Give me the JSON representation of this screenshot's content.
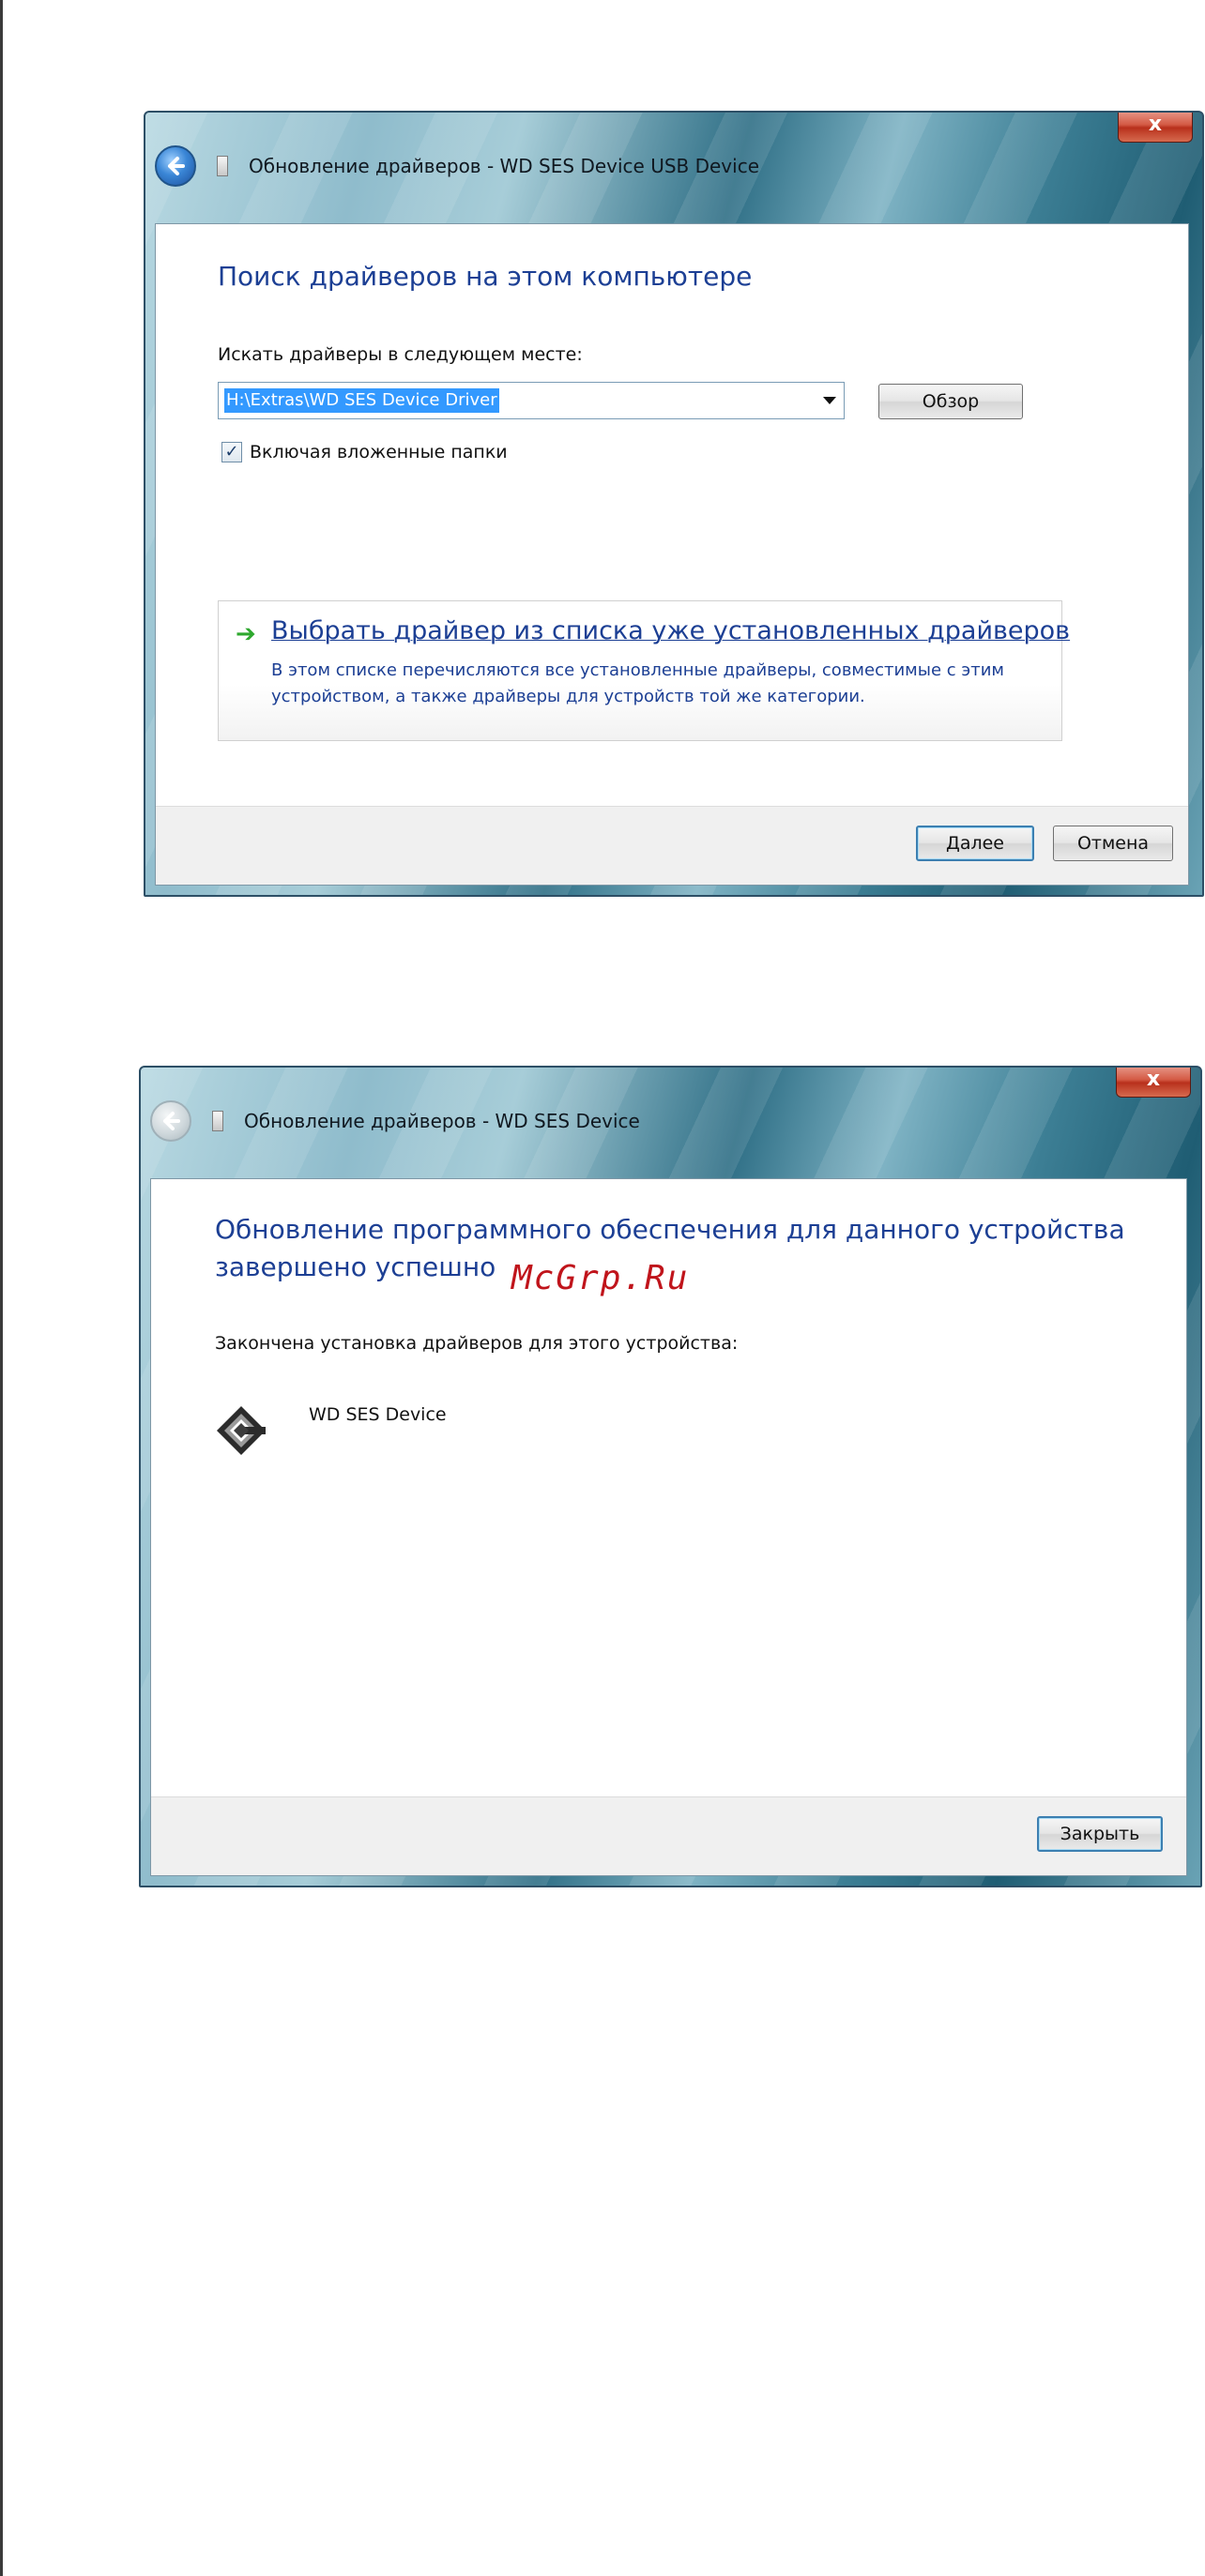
{
  "dialog1": {
    "close_label": "x",
    "title": "Обновление драйверов - WD SES Device USB Device",
    "heading": "Поиск драйверов на этом компьютере",
    "search_label": "Искать драйверы в следующем месте:",
    "path_value": "H:\\Extras\\WD SES Device Driver",
    "browse_label": "Обзор",
    "include_subfolders_label": "Включая вложенные папки",
    "include_subfolders_checked": true,
    "option_title": "Выбрать драйвер из списка уже установленных драйверов",
    "option_desc": "В этом списке перечисляются все установленные драйверы, совместимые с этим устройством, а также драйверы для устройств той же категории.",
    "next_label": "Далее",
    "cancel_label": "Отмена"
  },
  "dialog2": {
    "close_label": "x",
    "title": "Обновление драйверов - WD SES Device",
    "heading": "Обновление программного обеспечения для данного устройства завершено успешно",
    "install_label": "Закончена установка драйверов для этого устройства:",
    "device_name": "WD SES Device",
    "close_button_label": "Закрыть"
  },
  "watermark": "McGrp.Ru",
  "icons": {
    "back": "back-arrow-icon",
    "usb_device": "usb-device-icon",
    "green_arrow": "green-arrow-icon",
    "wd_device": "wd-device-icon",
    "checkmark": "checkmark-icon"
  }
}
